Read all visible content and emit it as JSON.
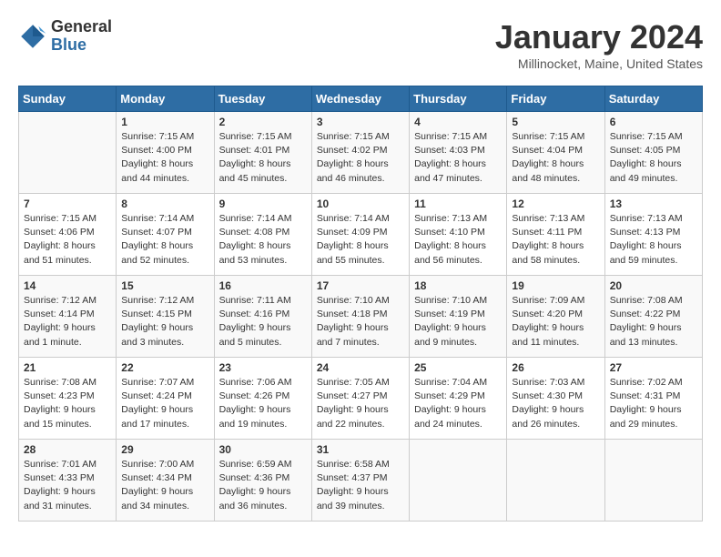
{
  "header": {
    "logo_general": "General",
    "logo_blue": "Blue",
    "month_title": "January 2024",
    "location": "Millinocket, Maine, United States"
  },
  "days_of_week": [
    "Sunday",
    "Monday",
    "Tuesday",
    "Wednesday",
    "Thursday",
    "Friday",
    "Saturday"
  ],
  "weeks": [
    [
      {
        "day": "",
        "info": ""
      },
      {
        "day": "1",
        "info": "Sunrise: 7:15 AM\nSunset: 4:00 PM\nDaylight: 8 hours\nand 44 minutes."
      },
      {
        "day": "2",
        "info": "Sunrise: 7:15 AM\nSunset: 4:01 PM\nDaylight: 8 hours\nand 45 minutes."
      },
      {
        "day": "3",
        "info": "Sunrise: 7:15 AM\nSunset: 4:02 PM\nDaylight: 8 hours\nand 46 minutes."
      },
      {
        "day": "4",
        "info": "Sunrise: 7:15 AM\nSunset: 4:03 PM\nDaylight: 8 hours\nand 47 minutes."
      },
      {
        "day": "5",
        "info": "Sunrise: 7:15 AM\nSunset: 4:04 PM\nDaylight: 8 hours\nand 48 minutes."
      },
      {
        "day": "6",
        "info": "Sunrise: 7:15 AM\nSunset: 4:05 PM\nDaylight: 8 hours\nand 49 minutes."
      }
    ],
    [
      {
        "day": "7",
        "info": "Sunrise: 7:15 AM\nSunset: 4:06 PM\nDaylight: 8 hours\nand 51 minutes."
      },
      {
        "day": "8",
        "info": "Sunrise: 7:14 AM\nSunset: 4:07 PM\nDaylight: 8 hours\nand 52 minutes."
      },
      {
        "day": "9",
        "info": "Sunrise: 7:14 AM\nSunset: 4:08 PM\nDaylight: 8 hours\nand 53 minutes."
      },
      {
        "day": "10",
        "info": "Sunrise: 7:14 AM\nSunset: 4:09 PM\nDaylight: 8 hours\nand 55 minutes."
      },
      {
        "day": "11",
        "info": "Sunrise: 7:13 AM\nSunset: 4:10 PM\nDaylight: 8 hours\nand 56 minutes."
      },
      {
        "day": "12",
        "info": "Sunrise: 7:13 AM\nSunset: 4:11 PM\nDaylight: 8 hours\nand 58 minutes."
      },
      {
        "day": "13",
        "info": "Sunrise: 7:13 AM\nSunset: 4:13 PM\nDaylight: 8 hours\nand 59 minutes."
      }
    ],
    [
      {
        "day": "14",
        "info": "Sunrise: 7:12 AM\nSunset: 4:14 PM\nDaylight: 9 hours\nand 1 minute."
      },
      {
        "day": "15",
        "info": "Sunrise: 7:12 AM\nSunset: 4:15 PM\nDaylight: 9 hours\nand 3 minutes."
      },
      {
        "day": "16",
        "info": "Sunrise: 7:11 AM\nSunset: 4:16 PM\nDaylight: 9 hours\nand 5 minutes."
      },
      {
        "day": "17",
        "info": "Sunrise: 7:10 AM\nSunset: 4:18 PM\nDaylight: 9 hours\nand 7 minutes."
      },
      {
        "day": "18",
        "info": "Sunrise: 7:10 AM\nSunset: 4:19 PM\nDaylight: 9 hours\nand 9 minutes."
      },
      {
        "day": "19",
        "info": "Sunrise: 7:09 AM\nSunset: 4:20 PM\nDaylight: 9 hours\nand 11 minutes."
      },
      {
        "day": "20",
        "info": "Sunrise: 7:08 AM\nSunset: 4:22 PM\nDaylight: 9 hours\nand 13 minutes."
      }
    ],
    [
      {
        "day": "21",
        "info": "Sunrise: 7:08 AM\nSunset: 4:23 PM\nDaylight: 9 hours\nand 15 minutes."
      },
      {
        "day": "22",
        "info": "Sunrise: 7:07 AM\nSunset: 4:24 PM\nDaylight: 9 hours\nand 17 minutes."
      },
      {
        "day": "23",
        "info": "Sunrise: 7:06 AM\nSunset: 4:26 PM\nDaylight: 9 hours\nand 19 minutes."
      },
      {
        "day": "24",
        "info": "Sunrise: 7:05 AM\nSunset: 4:27 PM\nDaylight: 9 hours\nand 22 minutes."
      },
      {
        "day": "25",
        "info": "Sunrise: 7:04 AM\nSunset: 4:29 PM\nDaylight: 9 hours\nand 24 minutes."
      },
      {
        "day": "26",
        "info": "Sunrise: 7:03 AM\nSunset: 4:30 PM\nDaylight: 9 hours\nand 26 minutes."
      },
      {
        "day": "27",
        "info": "Sunrise: 7:02 AM\nSunset: 4:31 PM\nDaylight: 9 hours\nand 29 minutes."
      }
    ],
    [
      {
        "day": "28",
        "info": "Sunrise: 7:01 AM\nSunset: 4:33 PM\nDaylight: 9 hours\nand 31 minutes."
      },
      {
        "day": "29",
        "info": "Sunrise: 7:00 AM\nSunset: 4:34 PM\nDaylight: 9 hours\nand 34 minutes."
      },
      {
        "day": "30",
        "info": "Sunrise: 6:59 AM\nSunset: 4:36 PM\nDaylight: 9 hours\nand 36 minutes."
      },
      {
        "day": "31",
        "info": "Sunrise: 6:58 AM\nSunset: 4:37 PM\nDaylight: 9 hours\nand 39 minutes."
      },
      {
        "day": "",
        "info": ""
      },
      {
        "day": "",
        "info": ""
      },
      {
        "day": "",
        "info": ""
      }
    ]
  ]
}
